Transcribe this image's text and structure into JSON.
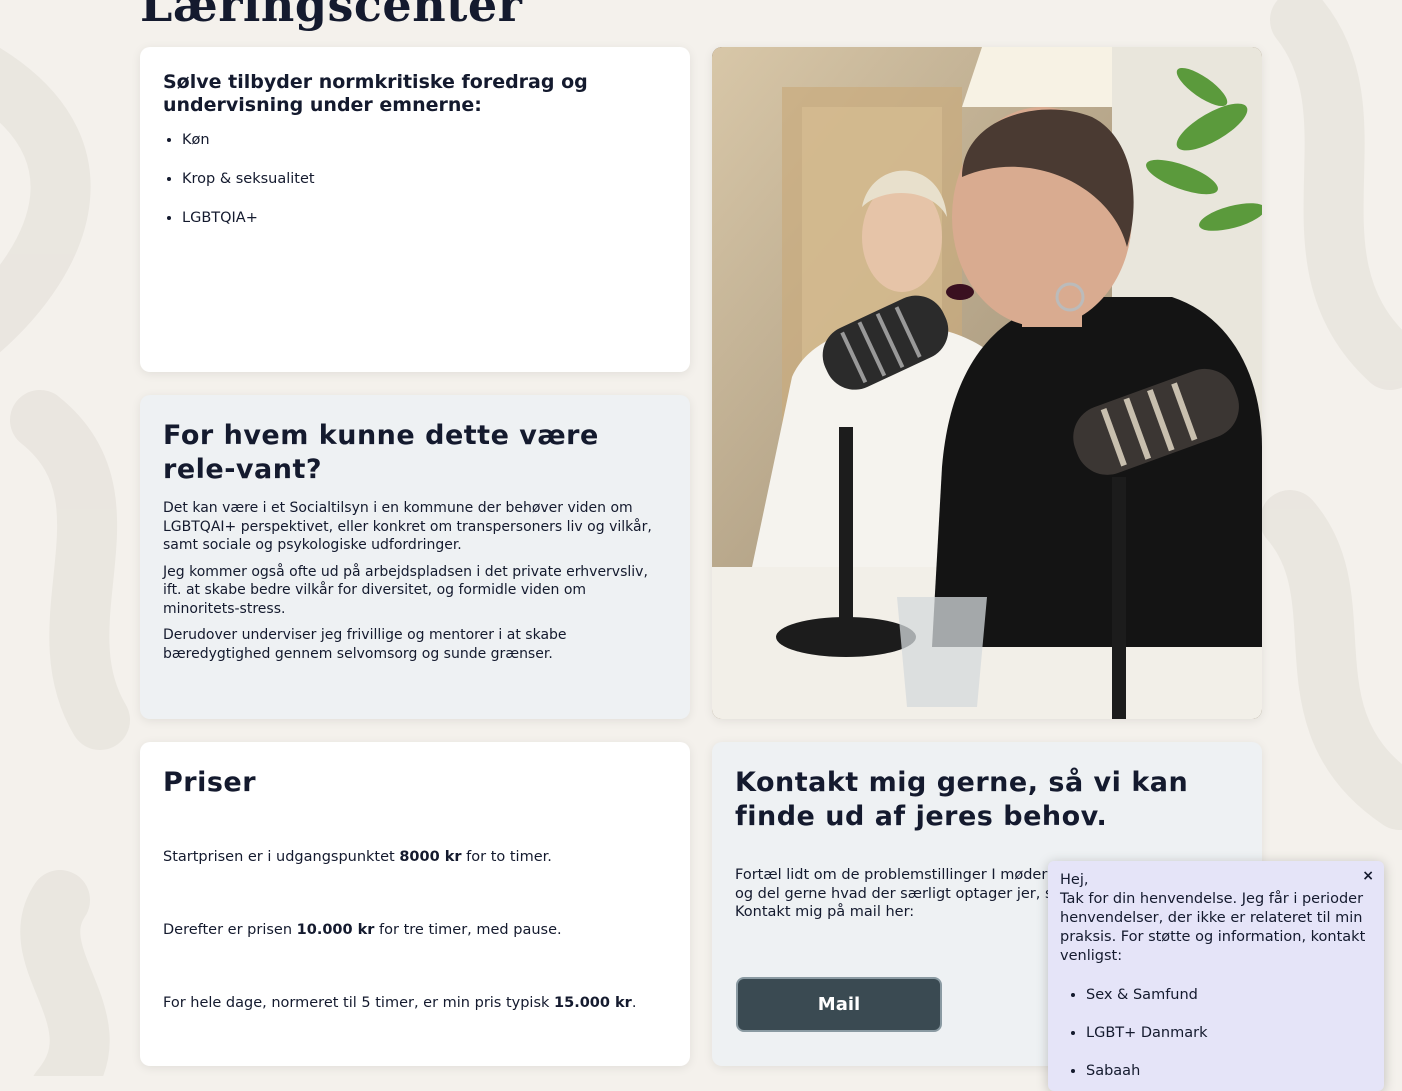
{
  "page": {
    "title": "Læringscenter"
  },
  "topics": {
    "heading": "Sølve tilbyder normkritiske foredrag og undervisning under emnerne:",
    "items": [
      "Køn",
      "Krop & seksualitet",
      "LGBTQIA+"
    ]
  },
  "audience": {
    "heading": "For hvem kunne dette være rele-vant?",
    "paragraphs": [
      "Det kan være i et Socialtilsyn i en kommune der behøver viden om LGBTQAI+ perspektivet, eller konkret om transpersoners liv og vilkår, samt sociale og psykologiske udfordringer.",
      "Jeg kommer også ofte ud på arbejdspladsen i det private erhvervsliv, ift. at skabe bedre vilkår for diversitet, og formidle viden om minoritets-stress.",
      "Derudover underviser jeg frivillige og mentorer i at skabe bæredygtighed gennem selvomsorg og sunde grænser."
    ]
  },
  "prices": {
    "heading": "Priser",
    "lines": [
      {
        "before": "Startprisen er i udgangspunktet ",
        "bold": "8000 kr",
        "after": " for to timer."
      },
      {
        "before": "Derefter er prisen ",
        "bold": "10.000 kr",
        "after": " for tre timer, med pause."
      },
      {
        "before": "For hele dage, normeret til 5 timer, er min pris typisk ",
        "bold": "15.000 kr",
        "after": "."
      }
    ]
  },
  "contact": {
    "heading": "Kontakt mig gerne, så vi kan finde ud af jeres behov.",
    "text_line1": "Fortæl lidt om de problemstillinger I møder I j",
    "text_line2": "og del gerne hvad der særligt optager jer, som",
    "text_line3": "Kontakt mig på mail her:",
    "button_label": "Mail"
  },
  "popup": {
    "close_label": "×",
    "greeting": "Hej,",
    "message": "Tak for din henvendelse. Jeg får i perioder henvendelser, der ikke er relateret til min praksis. For støtte og information, kontakt venligst:",
    "links": [
      "Sex & Samfund",
      "LGBT+ Danmark",
      "Sabaah"
    ]
  },
  "colors": {
    "background": "#f4f1ec",
    "text": "#141a2e",
    "button": "#3a4a52",
    "popup": "#e5e4f8"
  }
}
